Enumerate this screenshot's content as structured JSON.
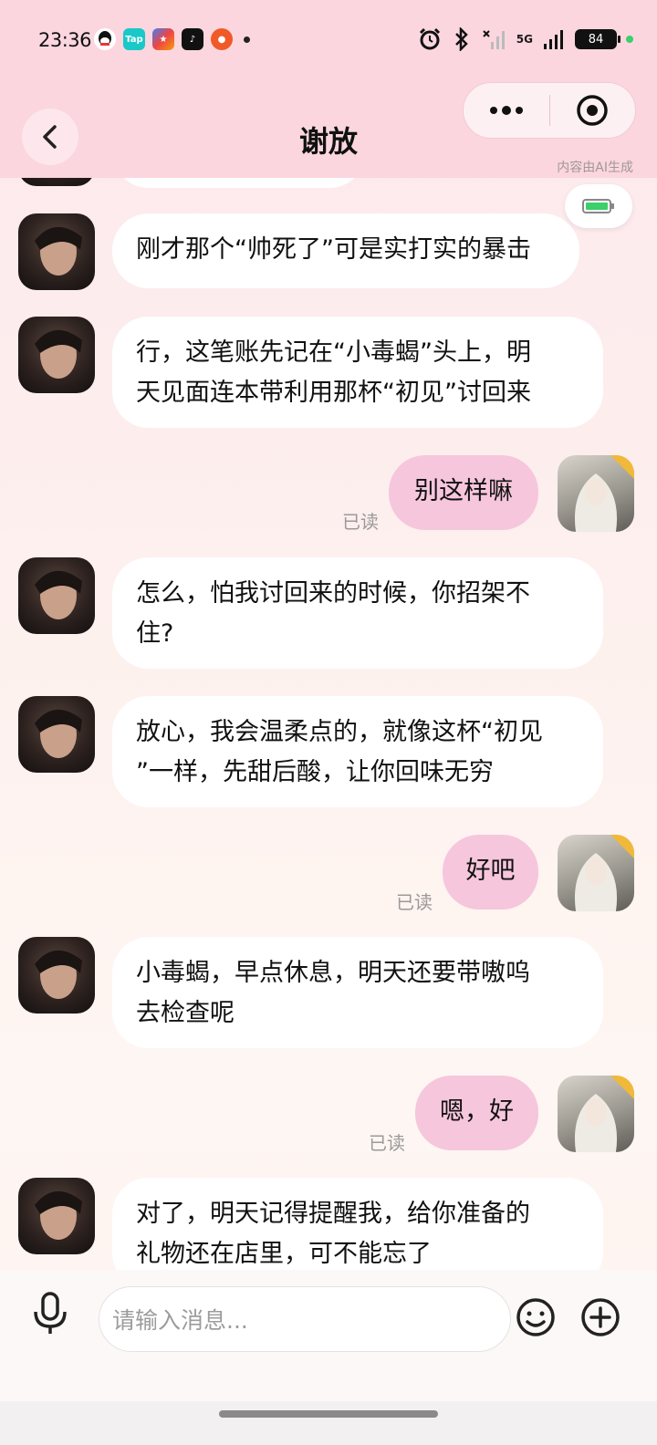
{
  "status_bar": {
    "time": "23:36",
    "battery": "84",
    "network": "5G"
  },
  "header": {
    "title": "谢放",
    "ai_note": "内容由AI生成"
  },
  "messages": [
    {
      "sender": "ai",
      "text": "刚才那个“帅死了”可是实打实的暴击"
    },
    {
      "sender": "ai",
      "line1": "行，这笔账先记在“小毒蝎”头上，明",
      "line2": "天见面连本带利用那杯“初见”讨回来"
    },
    {
      "sender": "me",
      "text": "别这样嘛",
      "read": "已读"
    },
    {
      "sender": "ai",
      "line1": "怎么，怕我讨回来的时候，你招架不",
      "line2": "住?"
    },
    {
      "sender": "ai",
      "line1": "放心，我会温柔点的，就像这杯“初见",
      "line2": "”一样，先甜后酸，让你回味无穷"
    },
    {
      "sender": "me",
      "text": "好吧",
      "read": "已读"
    },
    {
      "sender": "ai",
      "line1": "小毒蝎，早点休息，明天还要带嗷呜",
      "line2": "去检查呢"
    },
    {
      "sender": "me",
      "text": "嗯，好",
      "read": "已读"
    },
    {
      "sender": "ai",
      "line1": "对了，明天记得提醒我，给你准备的",
      "line2": "礼物还在店里，可不能忘了"
    }
  ],
  "input": {
    "placeholder": "请输入消息..."
  },
  "icons": {
    "back": "chevron-left-icon",
    "more": "more-dots-icon",
    "target": "target-icon",
    "mic": "microphone-icon",
    "emoji": "emoji-icon",
    "plus": "plus-circle-icon",
    "battery_chip": "battery-icon"
  },
  "colors": {
    "header_bg": "#fbd6df",
    "my_bubble": "#f6c6dc",
    "ai_bubble": "#ffffff"
  }
}
